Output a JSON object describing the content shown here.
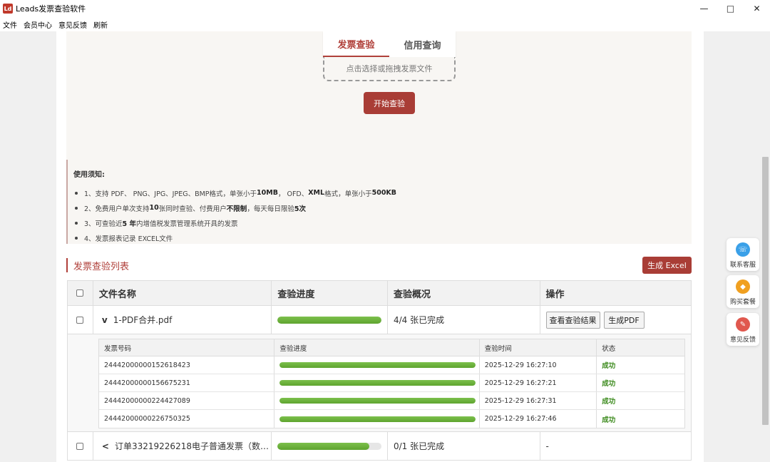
{
  "window": {
    "title": "Leads发票查验软件",
    "icon_text": "Ld",
    "menu": [
      "文件",
      "会员中心",
      "意见反馈",
      "刷新"
    ]
  },
  "upload": {
    "tabs": [
      {
        "label": "发票查验",
        "active": true
      },
      {
        "label": "信用查询",
        "active": false
      }
    ],
    "drop_text": "点击选择或拖拽发票文件",
    "start_button": "开始查验"
  },
  "notice": {
    "title": "使用须知:",
    "items": [
      [
        {
          "t": "1、支持 PDF、 PNG、JPG、JPEG、BMP格式，单张小于 "
        },
        {
          "t": "10MB",
          "b": true
        },
        {
          "t": "， OFD、"
        },
        {
          "t": "XML",
          "b": true
        },
        {
          "t": " 格式，单张小于 "
        },
        {
          "t": "500KB",
          "b": true
        }
      ],
      [
        {
          "t": "2、免费用户单次支持 "
        },
        {
          "t": "10",
          "b": true
        },
        {
          "t": " 张同时查验、付费用户"
        },
        {
          "t": "不限制",
          "b": true
        },
        {
          "t": "，每天每日限验 "
        },
        {
          "t": "5次",
          "b": true
        }
      ],
      [
        {
          "t": "3、可查验近 "
        },
        {
          "t": "5 年",
          "b": true
        },
        {
          "t": " 内增值税发票管理系统开具的发票"
        }
      ],
      [
        {
          "t": "4、发票报表记录 EXCEL文件"
        }
      ]
    ]
  },
  "list": {
    "title": "发票查验列表",
    "excel_button": "生成 Excel",
    "columns": [
      "文件名称",
      "查验进度",
      "查验概况",
      "操作"
    ],
    "files": [
      {
        "expander": "v",
        "name": "1-PDF合并.pdf",
        "progress": 1.0,
        "summary": "4/4 张已完成",
        "actions": [
          "查看查验结果",
          "生成PDF"
        ],
        "details": {
          "columns": [
            "发票号码",
            "查验进度",
            "查验时间",
            "状态"
          ],
          "rows": [
            {
              "number": "24442000000152618423",
              "progress": 1.0,
              "time": "2025-12-29 16:27:10",
              "status": "成功"
            },
            {
              "number": "24442000000156675231",
              "progress": 1.0,
              "time": "2025-12-29 16:27:21",
              "status": "成功"
            },
            {
              "number": "24442000000224427089",
              "progress": 1.0,
              "time": "2025-12-29 16:27:31",
              "status": "成功"
            },
            {
              "number": "24442000000226750325",
              "progress": 1.0,
              "time": "2025-12-29 16:27:46",
              "status": "成功"
            }
          ]
        }
      },
      {
        "expander": "<",
        "name": "订单33219226218电子普通发票（数…",
        "progress": 0.88,
        "summary": "0/1 张已完成",
        "actions_placeholder": "-"
      }
    ]
  },
  "side_widgets": [
    {
      "label": "联系客服",
      "icon": "headset-icon",
      "color": "#3aa0e8"
    },
    {
      "label": "购买套餐",
      "icon": "diamond-icon",
      "color": "#f0a020"
    },
    {
      "label": "意见反馈",
      "icon": "feedback-icon",
      "color": "#e0584e"
    }
  ]
}
